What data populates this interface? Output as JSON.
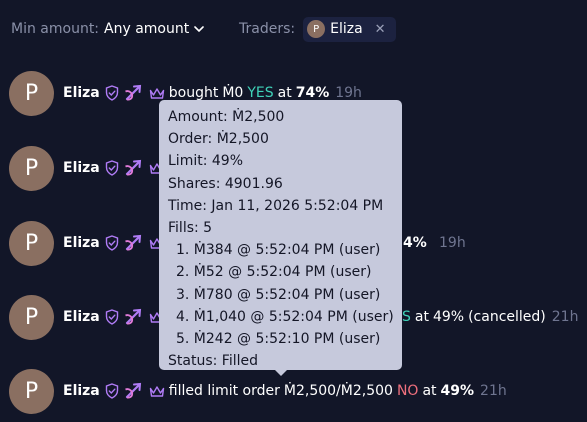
{
  "filters": {
    "min_amount_label": "Min amount:",
    "min_amount_value": "Any amount",
    "traders_label": "Traders:",
    "trader_chip": {
      "initial": "P",
      "name": "Eliza",
      "remove": "✕"
    }
  },
  "feed": [
    {
      "initial": "P",
      "name": "Eliza",
      "action": "bought",
      "amount": "Ṁ0",
      "outcome": "YES",
      "at": "at",
      "price": "74%",
      "time": "19h"
    },
    {
      "initial": "P",
      "name": "Eliza"
    },
    {
      "initial": "P",
      "name": "Eliza",
      "price": "4%",
      "time": "19h"
    },
    {
      "initial": "P",
      "name": "Eliza",
      "outcome_tail": "S",
      "at": "at",
      "price": "49%",
      "suffix": "(cancelled)",
      "time": "21h"
    },
    {
      "initial": "P",
      "name": "Eliza",
      "action": "filled limit order",
      "amount": "Ṁ2,500/Ṁ2,500",
      "outcome": "NO",
      "at": "at",
      "price": "49%",
      "time": "21h"
    }
  ],
  "tooltip": {
    "amount": "Amount: Ṁ2,500",
    "order": "Order: Ṁ2,500",
    "limit": "Limit: 49%",
    "shares": "Shares: 4901.96",
    "time": "Time: Jan 11, 2026 5:52:04 PM",
    "fills_label": "Fills: 5",
    "fills": [
      "1. Ṁ384 @ 5:52:04 PM (user)",
      "2. Ṁ52 @ 5:52:04 PM (user)",
      "3. Ṁ780 @ 5:52:04 PM (user)",
      "4. Ṁ1,040 @ 5:52:04 PM (user)",
      "5. Ṁ242 @ 5:52:10 PM (user)"
    ],
    "status": "Status: Filled"
  },
  "icons": {
    "shield": "shield-check-icon",
    "arrow": "crossed-arrow-icon",
    "crown": "crown-icon",
    "chevron": "chevron-down-icon"
  },
  "colors": {
    "background": "#121628",
    "yes": "#3fd2b8",
    "no": "#f0707e",
    "badge": "#b07cf6",
    "tooltip_bg": "#c6c9dc",
    "avatar": "#8a6f61"
  }
}
